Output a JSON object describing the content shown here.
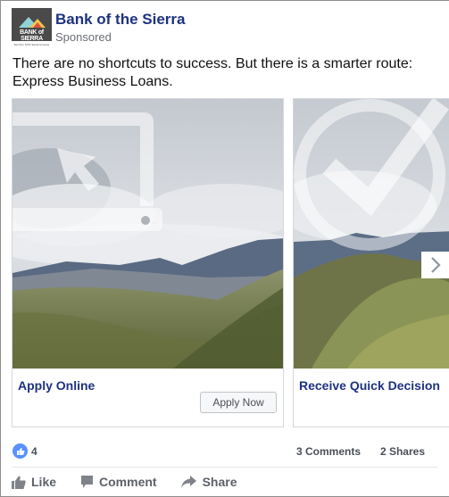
{
  "post": {
    "page_name": "Bank of the Sierra",
    "sponsored_label": "Sponsored",
    "logo": {
      "wordmark": "BANK of SIERRA",
      "subtext": "Member FDIC  Equal Housing Lender"
    },
    "message": "There are no shortcuts to success. But there is a smarter route: Express Business Loans."
  },
  "carousel": {
    "cards": [
      {
        "title": "Apply Online",
        "cta_label": "Apply Now",
        "overlay_icon": "laptop-cursor-icon"
      },
      {
        "title": "Receive Quick Decision",
        "overlay_icon": "check-circle-icon"
      }
    ],
    "next_icon": "chevron-right-icon"
  },
  "stats": {
    "reaction_icon": "like-icon",
    "likes": "4",
    "comments": "3 Comments",
    "shares": "2 Shares"
  },
  "actions": [
    {
      "label": "Like",
      "icon": "thumbs-up-icon"
    },
    {
      "label": "Comment",
      "icon": "comment-icon"
    },
    {
      "label": "Share",
      "icon": "share-arrow-icon"
    }
  ],
  "colors": {
    "brand_blue": "#1d3282",
    "like_blue": "#5890ff",
    "action_gray": "#5d6169"
  }
}
